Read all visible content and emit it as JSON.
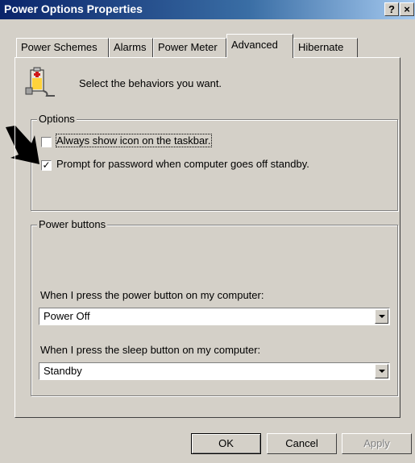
{
  "window": {
    "title": "Power Options Properties",
    "help_glyph": "?",
    "close_glyph": "×"
  },
  "tabs": [
    {
      "label": "Power Schemes",
      "active": false
    },
    {
      "label": "Alarms",
      "active": false
    },
    {
      "label": "Power Meter",
      "active": false
    },
    {
      "label": "Advanced",
      "active": true
    },
    {
      "label": "Hibernate",
      "active": false
    }
  ],
  "header": {
    "icon": "battery-icon",
    "text": "Select the behaviors you want."
  },
  "options": {
    "label": "Options",
    "items": [
      {
        "label": "Always show icon on the taskbar.",
        "checked": false
      },
      {
        "label": "Prompt for password when computer goes off standby.",
        "checked": true
      }
    ]
  },
  "power_buttons": {
    "label": "Power buttons",
    "power_label": "When I press the power button on my computer:",
    "power_value": "Power Off",
    "sleep_label": "When I press the sleep button on my computer:",
    "sleep_value": "Standby"
  },
  "buttons": {
    "ok": "OK",
    "cancel": "Cancel",
    "apply": "Apply"
  },
  "annotation": {
    "icon": "pointer-arrow-icon",
    "color": "#000000"
  },
  "colors": {
    "titlebar": "#0a246a",
    "dialog": "#d4d0c8"
  }
}
